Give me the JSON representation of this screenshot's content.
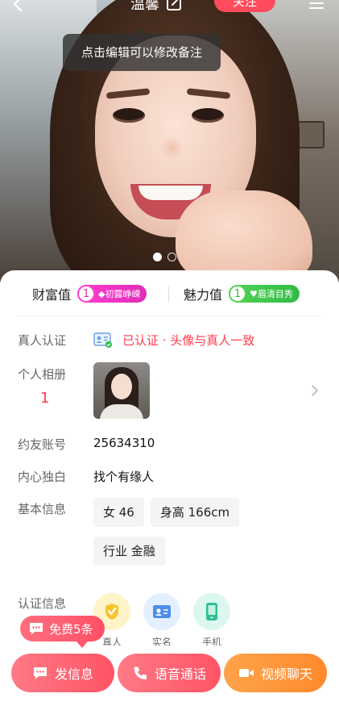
{
  "header": {
    "title": "温馨",
    "follow_label": "关注"
  },
  "tooltip": "点击编辑可以修改备注",
  "gallery": {
    "page_count": 2,
    "current_page": 1
  },
  "stats": {
    "wealth_label": "财富值",
    "wealth_level": "1",
    "wealth_title": "初露峥嵘",
    "charm_label": "魅力值",
    "charm_level": "1",
    "charm_title": "眉清目秀"
  },
  "profile": {
    "verify_label": "真人认证",
    "verify_value": "已认证 · 头像与真人一致",
    "album_label": "个人相册",
    "album_count": "1",
    "account_label": "约友账号",
    "account_value": "25634310",
    "monologue_label": "内心独白",
    "monologue_value": "找个有缘人",
    "basic_label": "基本信息",
    "tags": [
      "女 46",
      "身高 166cm",
      "行业 金融"
    ],
    "cert_label": "认证信息",
    "certs": [
      "真人",
      "实名",
      "手机"
    ]
  },
  "free_badge": "免费5条",
  "actions": {
    "message": "发信息",
    "voice": "语音通话",
    "video": "视频聊天"
  },
  "colors": {
    "accent": "#ff4b5c",
    "verify_text": "#ff3b4d",
    "video_button": "#ff8a2c",
    "wealth_badge": "#e02bb8",
    "charm_badge": "#2fbb45"
  }
}
